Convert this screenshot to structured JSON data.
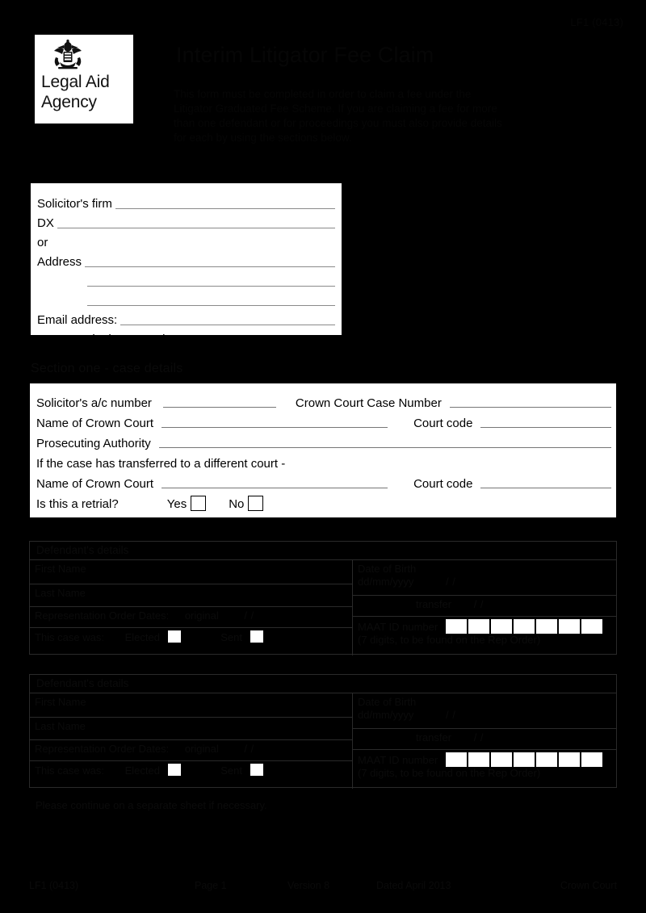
{
  "header": {
    "ref_code": "LF1 (0413)",
    "logo": {
      "line1": "Legal Aid",
      "line2": "Agency",
      "crest_icon": "royal-crest-icon"
    },
    "title": "Interim Litigator Fee Claim",
    "intro": "This form must be completed in order to claim a fee under the Litigator Graduated Fee Scheme. If you are claiming a fee for more than one defendant or for proceedings you must also provide details for each by using the sections below."
  },
  "solicitor_box": {
    "firm_label": "Solicitor's firm",
    "dx_label": "DX",
    "or_label": "or",
    "address_label": "Address",
    "email_label": "Email address:",
    "telephone_label": "Contact telephone number",
    "firm_value": "",
    "dx_value": "",
    "address_value_1": "",
    "address_value_2": "",
    "address_value_3": "",
    "email_value": "",
    "telephone_value": ""
  },
  "section_one": {
    "heading": "Section one - case details",
    "solicitor_ac_label": "Solicitor's a/c number",
    "solicitor_ac_value": "",
    "crown_case_label": "Crown Court Case Number",
    "crown_case_value": "",
    "court_name_label": "Name of Crown Court",
    "court_name_value": "",
    "court_code_label": "Court code",
    "court_code_value": "",
    "prosecuting_label": "Prosecuting Authority",
    "prosecuting_value": "",
    "transferred_note": "If the case has transferred to a different court -",
    "transferred_court_label": "Name of Crown Court",
    "transferred_court_value": "",
    "transferred_code_label": "Court code",
    "transferred_code_value": "",
    "retrial_label": "Is this a retrial?",
    "retrial_yes": "Yes",
    "retrial_no": "No",
    "retrial_yes_checked": false,
    "retrial_no_checked": false
  },
  "defendants": [
    {
      "title": "Defendant's details",
      "first_name_label": "First Name",
      "first_name_value": "",
      "last_name_label": "Last Name",
      "last_name_value": "",
      "dob_label": "Date of Birth",
      "dob_format": "dd/mm/yyyy",
      "dob_slashes": "/            /",
      "rep_order_label": "Representation Order Dates:",
      "rep_order_original": "original",
      "rep_order_original_slashes": "/        /",
      "rep_order_transfer": "transfer",
      "rep_order_transfer_slashes": "/        /",
      "case_was_label": "This case was:",
      "elected_label": "Elected",
      "sent_label": "Sent",
      "elected_checked": false,
      "sent_checked": false,
      "maat_label": "MAAT ID number",
      "maat_note": "(7 digits, to be found on the Rep Order)",
      "maat_digit_count": 7,
      "maat_digits": [
        "",
        "",
        "",
        "",
        "",
        "",
        ""
      ]
    },
    {
      "title": "Defendant's details",
      "first_name_label": "First Name",
      "first_name_value": "",
      "last_name_label": "Last Name",
      "last_name_value": "",
      "dob_label": "Date of Birth",
      "dob_format": "dd/mm/yyyy",
      "dob_slashes": "/            /",
      "rep_order_label": "Representation Order Dates:",
      "rep_order_original": "original",
      "rep_order_original_slashes": "/        /",
      "rep_order_transfer": "transfer",
      "rep_order_transfer_slashes": "/        /",
      "case_was_label": "This case was:",
      "elected_label": "Elected",
      "sent_label": "Sent",
      "elected_checked": false,
      "sent_checked": false,
      "maat_label": "MAAT ID number",
      "maat_note": "(7 digits, to be found on the Rep Order)",
      "maat_digit_count": 7,
      "maat_digits": [
        "",
        "",
        "",
        "",
        "",
        "",
        ""
      ]
    }
  ],
  "continue_note": "Please continue on a separate sheet if necessary.",
  "footer": {
    "code": "LF1 (0413)",
    "page": "Page 1",
    "version": "Version 8",
    "date": "Dated April 2013",
    "right": "Crown Court"
  }
}
